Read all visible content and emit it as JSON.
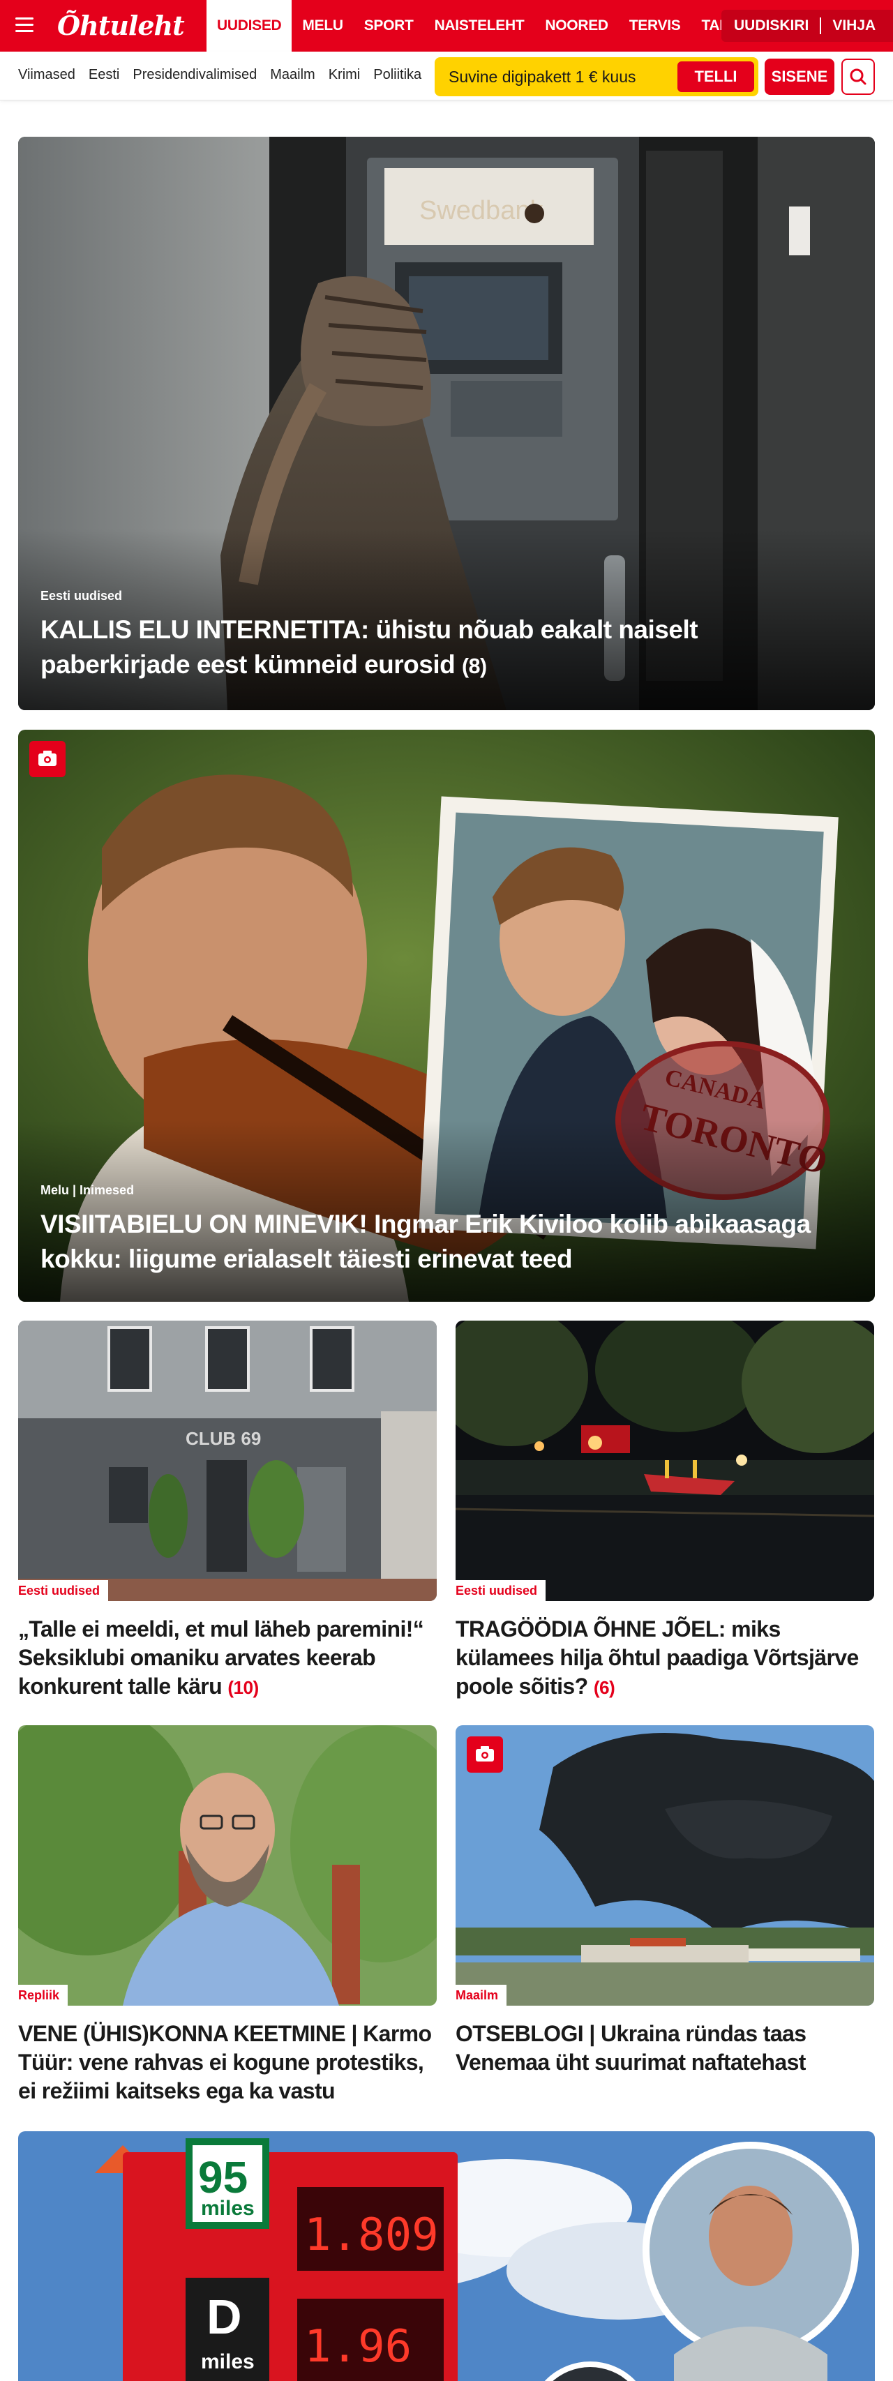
{
  "header": {
    "logo": "Õhtuleht",
    "main_nav": [
      "UUDISED",
      "MELU",
      "SPORT",
      "NAISTELEHT",
      "NOORED",
      "TERVIS",
      "TARBIJA"
    ],
    "right_nav": [
      "UUDISKIRI",
      "VIHJA"
    ]
  },
  "subheader": {
    "sub_nav": [
      "Viimased",
      "Eesti",
      "Presidendivalimised",
      "Maailm",
      "Krimi",
      "Poliitika"
    ],
    "promo_text": "Suvine digipakett 1 € kuus",
    "promo_button": "TELLI",
    "login_button": "SISENE"
  },
  "colors": {
    "brand_red": "#e4001b",
    "promo_yellow": "#ffd200"
  },
  "articles": [
    {
      "category": "Eesti uudised",
      "title": "KALLIS ELU INTERNETITA: ühistu nõuab eakalt naiselt paberkirjade eest kümneid eurosid",
      "comments": "(8)",
      "atm_sign": "Swedbank"
    },
    {
      "category": "Melu | Inimesed",
      "title": "VISIITABIELU ON MINEVIK! Ingmar Erik Kiviloo kolib abikaasaga kokku: liigume erialaselt täiesti erinevat teed",
      "comments": "",
      "has_gallery": true,
      "stamp_top": "CANADA",
      "stamp_main": "TORONTO"
    },
    {
      "category": "Eesti uudised",
      "title": "„Talle ei meeldi, et mul läheb paremini!“ Seksiklubi omaniku arvates keerab konkurent talle käru",
      "comments": "(10)",
      "sign": "CLUB 69"
    },
    {
      "category": "Eesti uudised",
      "title": "TRAGÖÖDIA ÕHNE JÕEL: miks külamees hilja õhtul paadiga Võrtsjärve poole sõitis?",
      "comments": "(6)"
    },
    {
      "category": "Repliik",
      "title": "VENE (ÜHIS)KONNA KEETMINE | Karmo Tüür: vene rahvas ei kogune protestiks, ei režiimi kaitseks ega ka vastu",
      "comments": ""
    },
    {
      "category": "Maailm",
      "title": "OTSEBLOGI | Ukraina ründas taas Venemaa üht suurimat naftatehast",
      "comments": "",
      "has_gallery": true
    },
    {
      "category": "",
      "title": "",
      "comments": "",
      "sign_95": "95",
      "sign_miles": "miles",
      "sign_d": "D",
      "price_1": "1.809",
      "price_2": "1.96"
    }
  ]
}
